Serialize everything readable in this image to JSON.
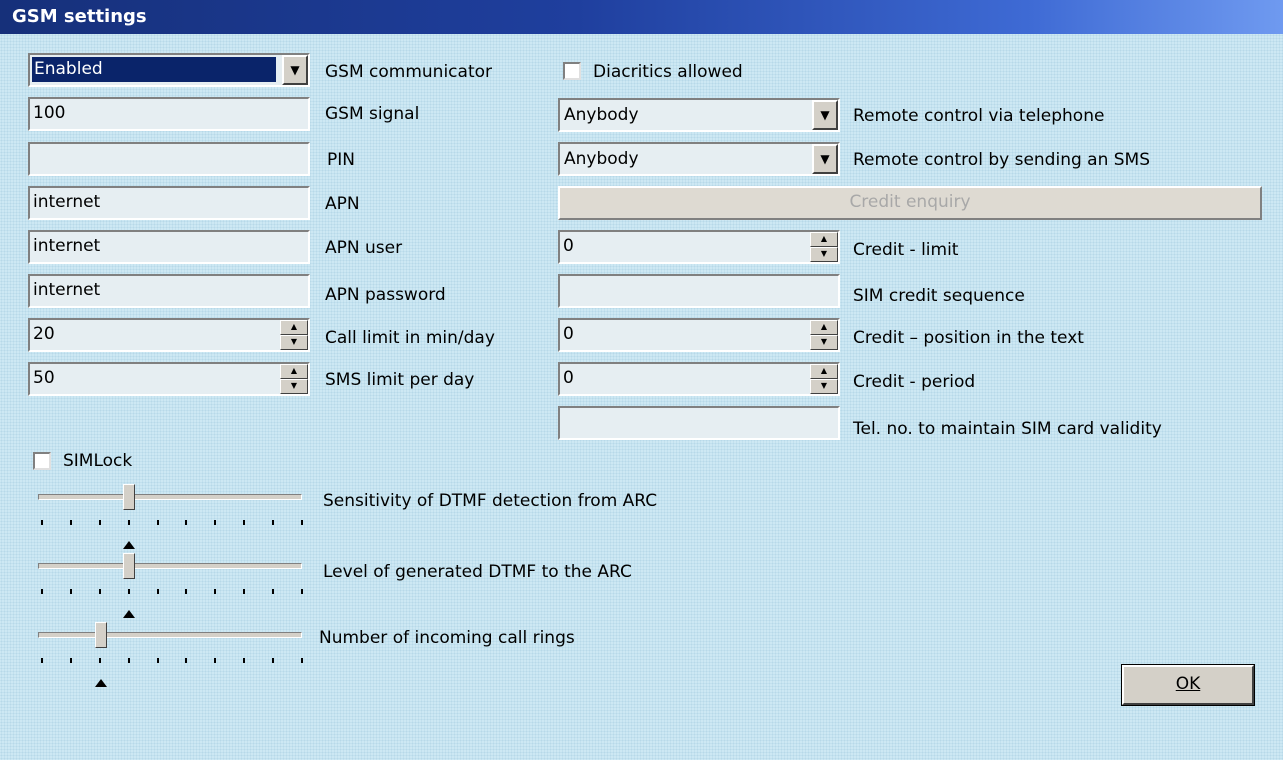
{
  "window": {
    "title": "GSM settings"
  },
  "left": {
    "gsm_communicator": {
      "value": "Enabled",
      "label": "GSM communicator"
    },
    "gsm_signal": {
      "value": "100",
      "label": "GSM signal"
    },
    "pin": {
      "value": "",
      "label": "PIN"
    },
    "apn": {
      "value": "internet",
      "label": "APN"
    },
    "apn_user": {
      "value": "internet",
      "label": "APN user"
    },
    "apn_password": {
      "value": "internet",
      "label": "APN password"
    },
    "call_limit": {
      "value": "20",
      "label": "Call limit in min/day"
    },
    "sms_limit": {
      "value": "50",
      "label": "SMS limit per day"
    }
  },
  "right": {
    "diacritics": {
      "label": "Diacritics allowed",
      "checked": false
    },
    "remote_tel": {
      "value": "Anybody",
      "label": "Remote control via telephone"
    },
    "remote_sms": {
      "value": "Anybody",
      "label": "Remote control by sending an SMS"
    },
    "credit_enquiry": {
      "label": "Credit enquiry",
      "enabled": false
    },
    "credit_limit": {
      "value": "0",
      "label": "Credit - limit"
    },
    "sim_credit_seq": {
      "value": "",
      "label": "SIM credit sequence"
    },
    "credit_position": {
      "value": "0",
      "label": "Credit – position in the text"
    },
    "credit_period": {
      "value": "0",
      "label": "Credit - period"
    },
    "tel_no": {
      "value": "",
      "label": "Tel. no. to maintain SIM card validity"
    }
  },
  "simlock": {
    "label": "SIMLock",
    "checked": false
  },
  "sliders": [
    {
      "label": "Sensitivity of DTMF detection from ARC",
      "level": 0.34
    },
    {
      "label": "Level of generated DTMF to the ARC",
      "level": 0.34
    },
    {
      "label": "Number of incoming call rings",
      "level": 0.23
    }
  ],
  "ok_button": {
    "label": "OK"
  },
  "colors": {
    "title_start": "#16307a",
    "title_end": "#6f9af0",
    "background": "#cde8f3"
  }
}
